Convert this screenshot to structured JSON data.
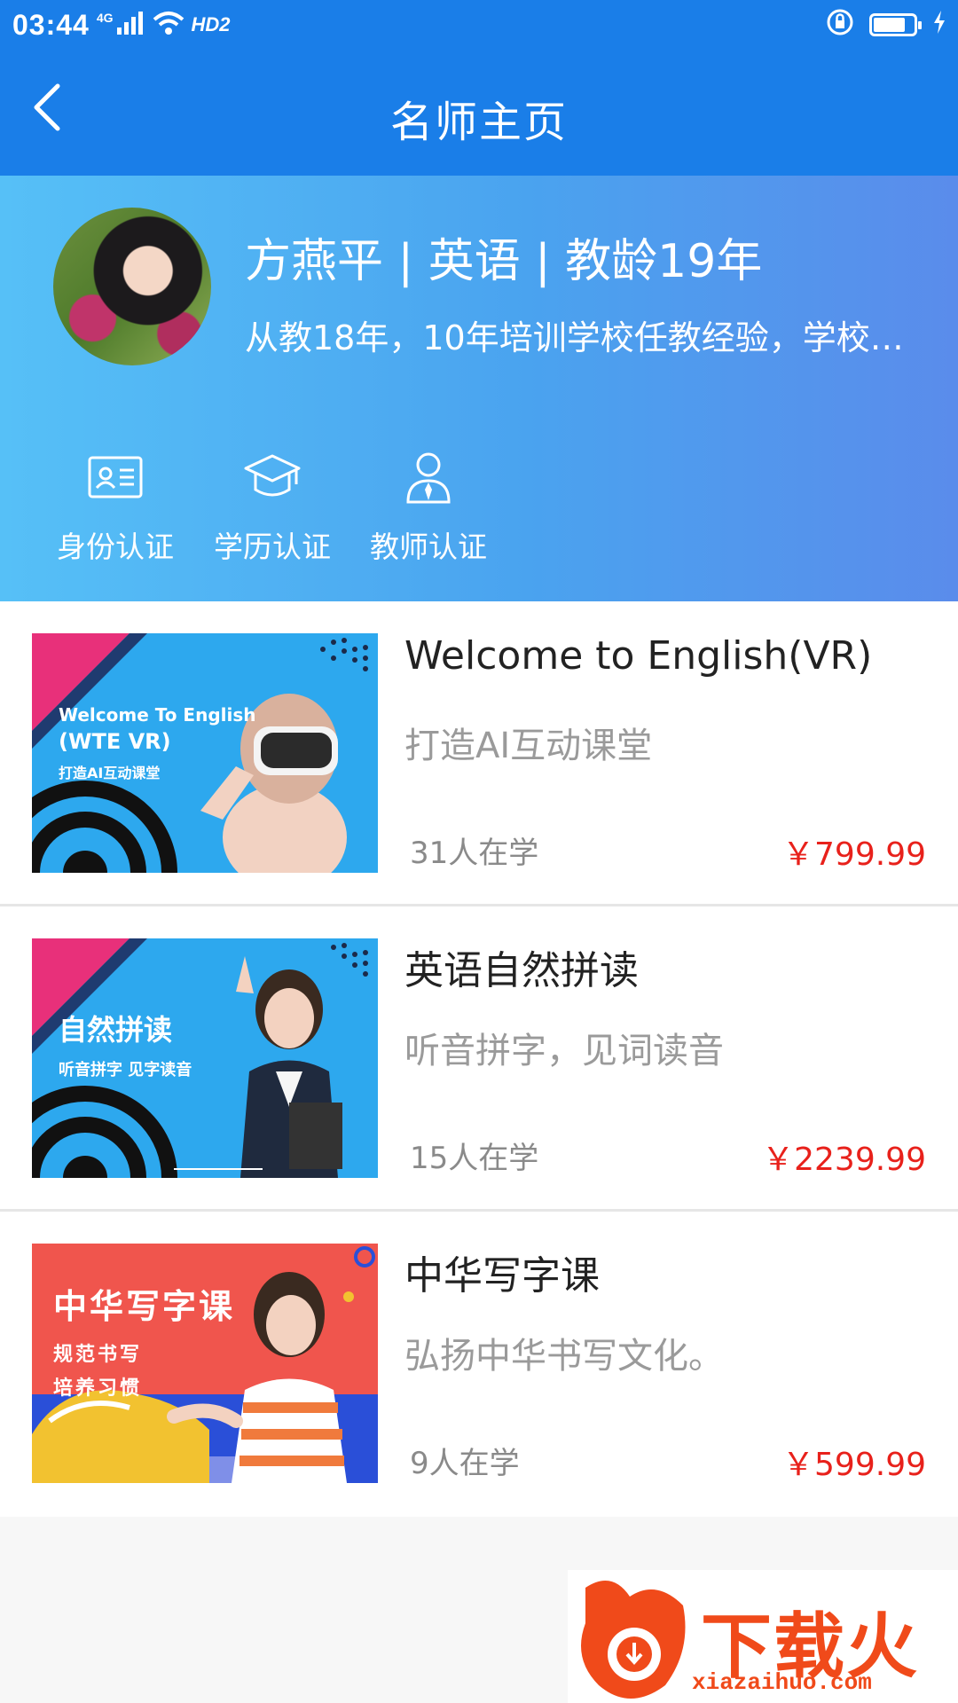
{
  "status_bar": {
    "time": "03:44",
    "network": "4G",
    "hd_label": "HD2",
    "battery_level": 0.8
  },
  "nav": {
    "title": "名师主页",
    "back_icon": "chevron-left-icon"
  },
  "teacher": {
    "name_line": "方燕平 | 英语 | 教龄19年",
    "description": "从教18年，10年培训学校任教经验，学校…",
    "certifications": [
      {
        "icon": "id-card-icon",
        "label": "身份认证"
      },
      {
        "icon": "graduation-cap-icon",
        "label": "学历认证"
      },
      {
        "icon": "teacher-icon",
        "label": "教师认证"
      }
    ]
  },
  "courses": [
    {
      "title": "Welcome to English(VR)",
      "subtitle": "打造AI互动课堂",
      "learners": "31人在学",
      "price": "￥799.99",
      "thumb_lines": [
        "Welcome To English",
        "(WTE VR)",
        "打造AI互动课堂"
      ],
      "thumb_bg": "#2da8ee"
    },
    {
      "title": "英语自然拼读",
      "subtitle": "听音拼字，见词读音",
      "learners": "15人在学",
      "price": "￥2239.99",
      "thumb_lines": [
        "自然拼读",
        "听音拼字 见字读音"
      ],
      "thumb_bg": "#2da8ee"
    },
    {
      "title": "中华写字课",
      "subtitle": "弘扬中华书写文化。",
      "learners": "9人在学",
      "price": "￥599.99",
      "thumb_lines": [
        "中华写字课",
        "规范书写",
        "培养习惯"
      ],
      "thumb_bg": "#f0554d"
    }
  ],
  "watermark": {
    "brand": "下载火",
    "url": "xiazaihuo.com"
  },
  "colors": {
    "primary": "#1a7ee8",
    "price": "#e8211b"
  }
}
